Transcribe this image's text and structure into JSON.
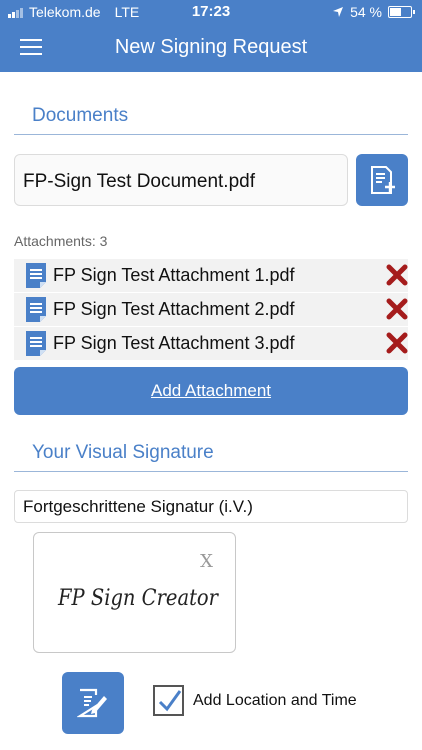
{
  "status_bar": {
    "carrier": "Telekom.de",
    "network": "LTE",
    "time": "17:23",
    "battery": "54 %",
    "battery_level": 0.54
  },
  "navbar": {
    "title": "New Signing Request"
  },
  "documents": {
    "section_title": "Documents",
    "file_name": "FP-Sign Test Document.pdf",
    "attachments_label": "Attachments: 3",
    "attachments": [
      {
        "name": "FP Sign Test Attachment 1.pdf"
      },
      {
        "name": "FP Sign Test Attachment 2.pdf"
      },
      {
        "name": "FP Sign Test Attachment 3.pdf"
      }
    ],
    "add_attachment_label": "Add Attachment"
  },
  "signature": {
    "section_title": "Your Visual Signature",
    "type_value": "Fortgeschrittene Signatur (i.V.)",
    "close_label": "X",
    "signature_image_text": "FP Sign Creator",
    "location_time_label": "Add Location and Time",
    "location_time_checked": true
  },
  "colors": {
    "accent": "#4a80c8",
    "delete": "#a51c1c"
  }
}
